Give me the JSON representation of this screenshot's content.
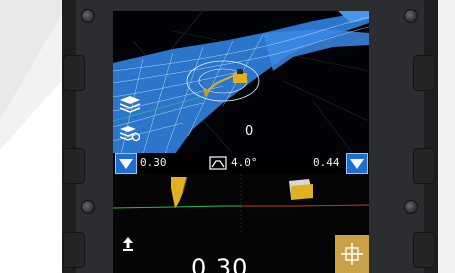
{
  "screen": {
    "gauge_bar": {
      "left_value": "0.30",
      "slope_value": "4.0°",
      "right_value": "0.44"
    },
    "map_label": "0",
    "bottom_panel": {
      "readout": "0.30"
    },
    "icons": {
      "layers_top": "layers-stack-icon",
      "layers_bottom": "layers-settings-icon",
      "left_down": "down-triangle-icon",
      "right_down": "down-triangle-icon",
      "slope": "slope-icon",
      "up_arrow": "up-arrow-icon",
      "target": "crosshair-target-icon",
      "left_bucket": "bucket-icon",
      "right_bucket": "bucket-side-icon"
    },
    "colors": {
      "model_surface": "#3b86e0",
      "button_blue": "#1b6fd2",
      "target_button": "#c9a248",
      "bucket": "#e0b020",
      "profile_left": "#21c24a",
      "profile_right": "#d03030"
    }
  }
}
